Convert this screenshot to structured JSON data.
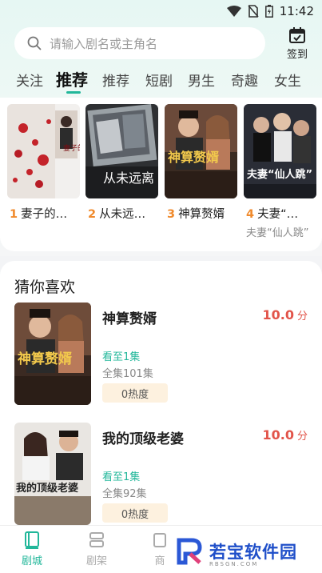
{
  "status_bar": {
    "time": "11:42",
    "icons": [
      "wifi-icon",
      "no-sim-icon",
      "battery-icon"
    ]
  },
  "search": {
    "placeholder": "请输入剧名或主角名"
  },
  "signin": {
    "label": "签到"
  },
  "tabs": [
    "关注",
    "推荐",
    "推荐",
    "短剧",
    "男生",
    "奇趣",
    "女生"
  ],
  "active_tab_index": 1,
  "recommend": [
    {
      "rank": "1",
      "title": "妻子的…",
      "poster_text": "妻子的秘密"
    },
    {
      "rank": "2",
      "title": "从未远…",
      "poster_text": "从未远离"
    },
    {
      "rank": "3",
      "title": "神算赘婿",
      "poster_text": "神算赘婿"
    },
    {
      "rank": "4",
      "title": "夫妻“…",
      "subtitle": "夫妻“仙人跳”",
      "poster_text": "夫妻“仙人跳”"
    }
  ],
  "guess": {
    "title": "猜你喜欢",
    "items": [
      {
        "name": "神算赘婿",
        "score": "10.0",
        "score_unit": "分",
        "watched": "看至1集",
        "total": "全集101集",
        "heat": "0热度",
        "cover_text": "神算赘婿"
      },
      {
        "name": "我的顶级老婆",
        "score": "10.0",
        "score_unit": "分",
        "watched": "看至1集",
        "total": "全集92集",
        "heat": "0热度",
        "cover_text": "我的顶级老婆"
      }
    ]
  },
  "bottom_nav": [
    {
      "label": "剧城",
      "icon": "book-icon",
      "active": true
    },
    {
      "label": "剧架",
      "icon": "shelf-icon",
      "active": false
    },
    {
      "label": "商",
      "icon": "store-icon",
      "active": false
    }
  ],
  "watermark": {
    "brand": "若宝软件园",
    "sub": "RBSGN.COM"
  },
  "colors": {
    "accent": "#22b79a",
    "rank": "#f08a2c",
    "score": "#e2544a",
    "heat_bg": "#fdf1df"
  }
}
